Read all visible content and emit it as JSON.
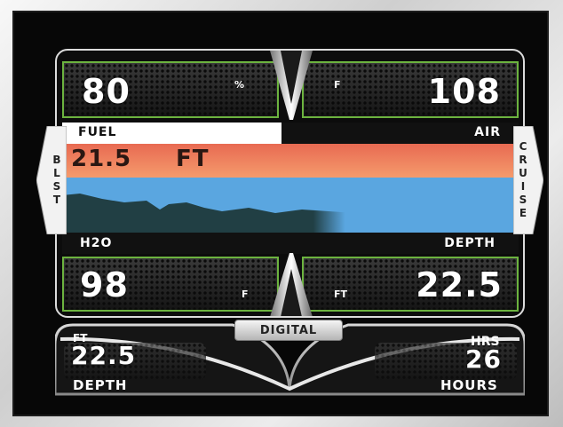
{
  "top_left": {
    "value": "80",
    "unit": "%",
    "label": "FUEL"
  },
  "top_right": {
    "value": "108",
    "unit": "F",
    "label": "AIR"
  },
  "depth_banner": {
    "value": "21.5",
    "unit": "FT"
  },
  "bottom_left": {
    "value": "98",
    "unit": "F",
    "label": "H2O"
  },
  "bottom_right": {
    "value": "22.5",
    "unit": "FT",
    "label": "DEPTH"
  },
  "side_tabs": {
    "left": "BLST",
    "right": "CRUISE"
  },
  "digital_button": "DIGITAL",
  "footer": {
    "left_unit": "FT",
    "left_value": "22.5",
    "left_label": "DEPTH",
    "right_unit": "HRS",
    "right_value": "26",
    "right_label": "HOURS"
  },
  "fuel_level": 0.48,
  "colors": {
    "accent_green": "#6cb33f",
    "water": "#5aa6e0",
    "sky": "#f0735a"
  }
}
